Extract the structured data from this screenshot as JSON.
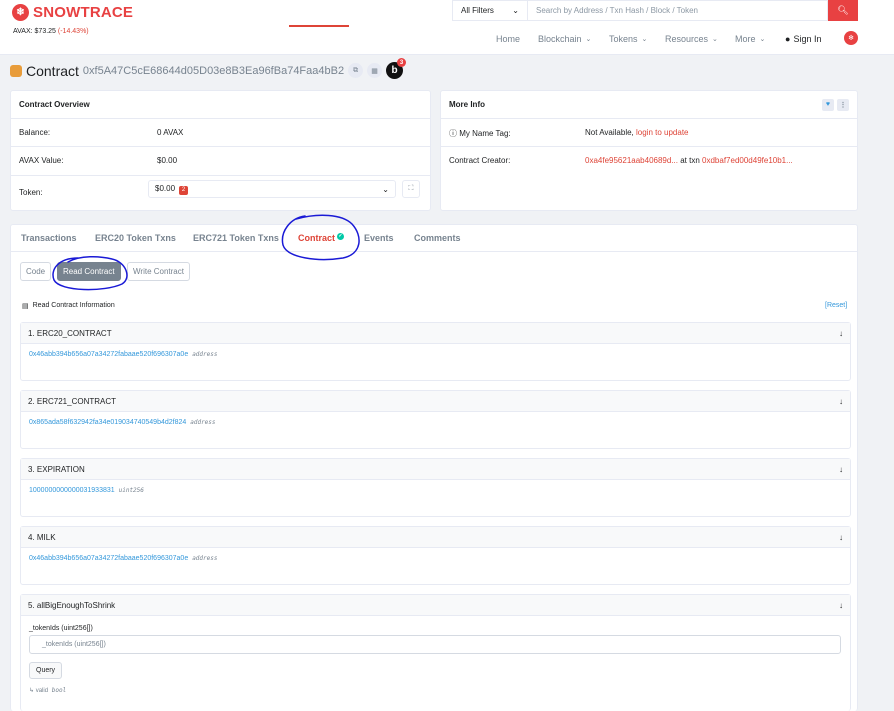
{
  "header": {
    "brand": "SNOWTRACE",
    "price_label": "AVAX: $73.25",
    "price_change": "(-14.43%)",
    "filter_label": "All Filters",
    "search_placeholder": "Search by Address / Txn Hash / Block / Token",
    "nav": [
      "Home",
      "Blockchain",
      "Tokens",
      "Resources",
      "More",
      "Sign In"
    ]
  },
  "page": {
    "title_label": "Contract",
    "address": "0xf5A47C5cE68644d05D03e8B3Ea96fBa74Faa4bB2",
    "b_badge_count": "3"
  },
  "overview": {
    "title": "Contract Overview",
    "balance_label": "Balance:",
    "balance_value": "0 AVAX",
    "value_label": "AVAX Value:",
    "value_value": "$0.00",
    "token_label": "Token:",
    "token_value": "$0.00",
    "token_badge": "2"
  },
  "more_info": {
    "title": "More Info",
    "name_tag_label": "My Name Tag:",
    "name_tag_value": "Not Available,",
    "name_tag_link": "login to update",
    "creator_label": "Contract Creator:",
    "creator_addr": "0xa4fe95621aab40689d...",
    "creator_at": "at txn",
    "creator_txn": "0xdbaf7ed00d49fe10b1..."
  },
  "tabs": [
    "Transactions",
    "ERC20 Token Txns",
    "ERC721 Token Txns",
    "Contract",
    "Events",
    "Comments"
  ],
  "subtabs": [
    "Code",
    "Read Contract",
    "Write Contract"
  ],
  "read": {
    "info": "Read Contract Information",
    "reset": "[Reset]",
    "functions": [
      {
        "name": "1. ERC20_CONTRACT",
        "value": "0x46abb394b656a07a34272fabaae520f696307a0e",
        "type": "address"
      },
      {
        "name": "2. ERC721_CONTRACT",
        "value": "0x865ada58f632942fa34e019034740549b4d2f824",
        "type": "address"
      },
      {
        "name": "3. EXPIRATION",
        "value": "1000000000000031933831",
        "type": "uint256"
      },
      {
        "name": "4. MILK",
        "value": "0x46abb394b656a07a34272fabaae520f696307a0e",
        "type": "address"
      },
      {
        "name": "5. allBigEnoughToShrink",
        "param_label": "_tokenIds (uint256[])",
        "placeholder": "_tokenIds (uint256[])",
        "button": "Query",
        "output_prefix": "valid",
        "output_type": "bool"
      }
    ]
  },
  "colors": {
    "brand": "#e84142",
    "link": "#3498db",
    "annotation": "#1a1ad6"
  }
}
